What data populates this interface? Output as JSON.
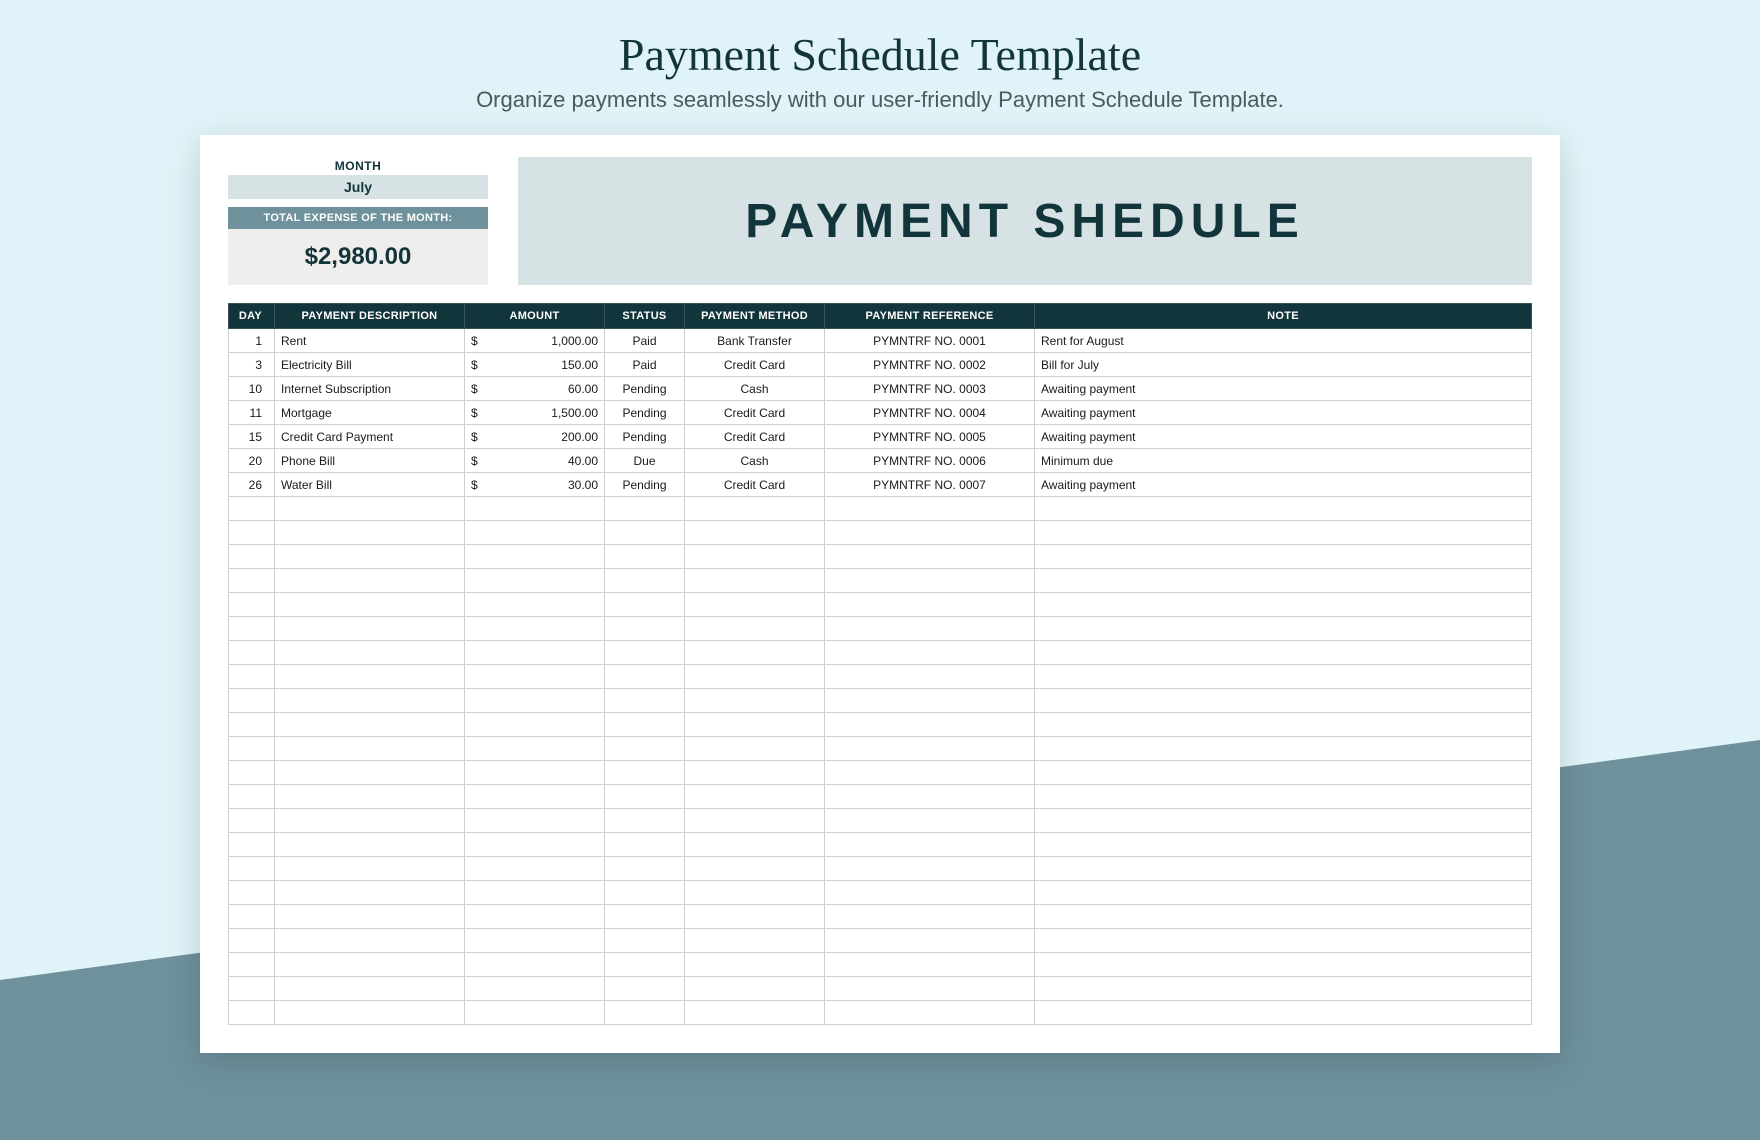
{
  "page": {
    "title": "Payment Schedule Template",
    "subtitle": "Organize payments seamlessly with our user-friendly Payment Schedule Template."
  },
  "summary": {
    "month_label": "MONTH",
    "month_value": "July",
    "total_label": "TOTAL EXPENSE OF THE MONTH:",
    "total_value": "$2,980.00"
  },
  "banner": {
    "text": "PAYMENT SHEDULE"
  },
  "table": {
    "headers": {
      "day": "DAY",
      "description": "PAYMENT DESCRIPTION",
      "amount": "AMOUNT",
      "status": "STATUS",
      "method": "PAYMENT METHOD",
      "reference": "PAYMENT REFERENCE",
      "note": "NOTE"
    },
    "currency": "$",
    "rows": [
      {
        "day": "1",
        "description": "Rent",
        "amount": "1,000.00",
        "status": "Paid",
        "method": "Bank Transfer",
        "reference": "PYMNTRF NO. 0001",
        "note": "Rent for August"
      },
      {
        "day": "3",
        "description": "Electricity Bill",
        "amount": "150.00",
        "status": "Paid",
        "method": "Credit Card",
        "reference": "PYMNTRF NO. 0002",
        "note": "Bill for July"
      },
      {
        "day": "10",
        "description": "Internet Subscription",
        "amount": "60.00",
        "status": "Pending",
        "method": "Cash",
        "reference": "PYMNTRF NO. 0003",
        "note": "Awaiting payment"
      },
      {
        "day": "11",
        "description": "Mortgage",
        "amount": "1,500.00",
        "status": "Pending",
        "method": "Credit Card",
        "reference": "PYMNTRF NO. 0004",
        "note": "Awaiting payment"
      },
      {
        "day": "15",
        "description": "Credit Card Payment",
        "amount": "200.00",
        "status": "Pending",
        "method": "Credit Card",
        "reference": "PYMNTRF NO. 0005",
        "note": "Awaiting payment"
      },
      {
        "day": "20",
        "description": "Phone Bill",
        "amount": "40.00",
        "status": "Due",
        "method": "Cash",
        "reference": "PYMNTRF NO. 0006",
        "note": "Minimum due"
      },
      {
        "day": "26",
        "description": "Water Bill",
        "amount": "30.00",
        "status": "Pending",
        "method": "Credit Card",
        "reference": "PYMNTRF NO. 0007",
        "note": "Awaiting payment"
      }
    ],
    "empty_rows": 22
  }
}
